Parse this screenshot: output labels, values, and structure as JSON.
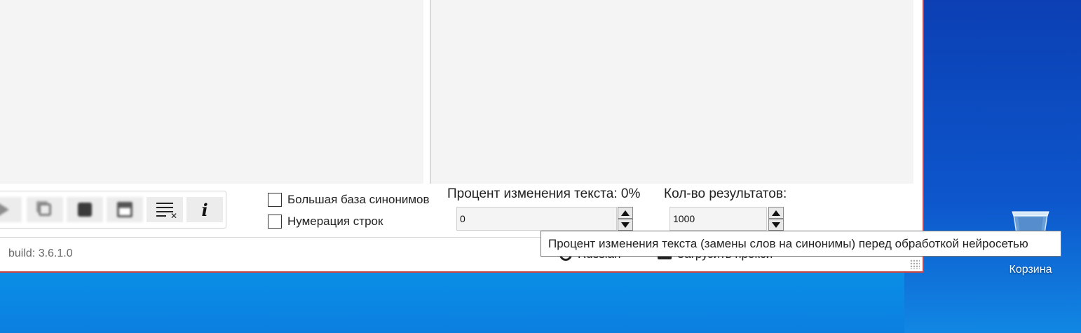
{
  "toolbar": {
    "buttons": [
      "play",
      "copy",
      "randomize",
      "save",
      "clear-list",
      "info"
    ],
    "info_label": "i"
  },
  "options": {
    "synonyms_db_label": "Большая база синонимов",
    "line_numbers_label": "Нумерация строк"
  },
  "percent": {
    "label": "Процент изменения текста: 0%",
    "value": "0"
  },
  "results": {
    "label": "Кол-во результатов:",
    "value": "1000"
  },
  "footer": {
    "build": "build: 3.6.1.0",
    "language": "Russian",
    "load_proxy": "Загрузить прокси"
  },
  "tooltip": {
    "text": "Процент изменения текста (замены слов на синонимы) перед обработкой нейросетью"
  },
  "desktop": {
    "recycle_bin_label": "Корзина"
  },
  "colors": {
    "window_border": "#c64545",
    "pane_bg": "#f4f4f4",
    "desktop_blue": "#0a66d8"
  }
}
